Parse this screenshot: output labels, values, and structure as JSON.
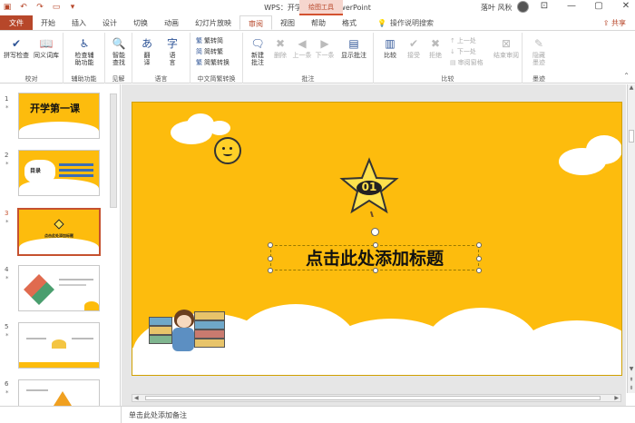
{
  "titlebar": {
    "title": "WPS：开学第一课 - PowerPoint",
    "context_tool": "绘图工具",
    "user": "落叶 风秋",
    "window_buttons": [
      "—",
      "▢",
      "✕"
    ]
  },
  "tabs": [
    "文件",
    "开始",
    "插入",
    "设计",
    "切换",
    "动画",
    "幻灯片放映",
    "审阅",
    "视图",
    "帮助",
    "格式"
  ],
  "active_tab": "审阅",
  "tellme": "操作说明搜索",
  "share": "共享",
  "ribbon": {
    "groups": [
      {
        "label": "校对",
        "buttons": [
          "拼写检查",
          "同义词库"
        ]
      },
      {
        "label": "辅助功能",
        "buttons": [
          "检查辅助功能"
        ]
      },
      {
        "label": "见解",
        "buttons": [
          "智能查找"
        ]
      },
      {
        "label": "语言",
        "buttons": [
          "翻译",
          "语言"
        ]
      },
      {
        "label": "中文简繁转换",
        "buttons": [
          "繁转简",
          "简转繁",
          "简繁转换"
        ]
      },
      {
        "label": "批注",
        "buttons": [
          "新建批注",
          "删除",
          "上一条",
          "下一条",
          "显示批注"
        ]
      },
      {
        "label": "比较",
        "buttons": [
          "比较",
          "接受",
          "拒绝",
          "上一处",
          "下一处",
          "审阅窗格",
          "结束审阅"
        ]
      },
      {
        "label": "墨迹",
        "buttons": [
          "隐藏墨迹"
        ]
      }
    ]
  },
  "slides": [
    {
      "num": "1",
      "star": "*",
      "caption": "开学第一课"
    },
    {
      "num": "2",
      "star": "*",
      "caption": "目录"
    },
    {
      "num": "3",
      "star": "*",
      "caption": "点击此处添加标题"
    },
    {
      "num": "4",
      "star": "*",
      "caption": ""
    },
    {
      "num": "5",
      "star": "*",
      "caption": ""
    },
    {
      "num": "6",
      "star": "*",
      "caption": ""
    }
  ],
  "selected_slide": "3",
  "main_slide": {
    "badge": "01",
    "title": "点击此处添加标题"
  },
  "notes_placeholder": "单击此处添加备注",
  "colors": {
    "accent": "#b7472a",
    "slide_bg": "#fdbc0d"
  }
}
